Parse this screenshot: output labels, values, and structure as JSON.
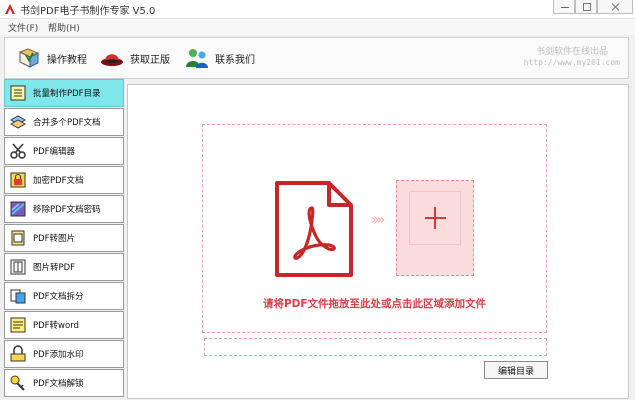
{
  "window": {
    "title": "书剑PDF电子书制作专家 V5.0"
  },
  "menu": [
    {
      "label": "文件(F)"
    },
    {
      "label": "帮助(H)"
    }
  ],
  "toolbar": {
    "items": [
      {
        "label": "操作教程",
        "icon": "book-icon"
      },
      {
        "label": "获取正版",
        "icon": "red-hat-icon"
      },
      {
        "label": "联系我们",
        "icon": "contacts-icon"
      }
    ],
    "brand_name": "书剑软件在线出品",
    "brand_url": "http://www.my201.com"
  },
  "sidebar": {
    "items": [
      {
        "label": "批量制作PDF目录",
        "icon": "catalog-icon",
        "active": true
      },
      {
        "label": "合并多个PDF文档",
        "icon": "merge-icon"
      },
      {
        "label": "PDF编辑器",
        "icon": "editor-icon"
      },
      {
        "label": "加密PDF文档",
        "icon": "encrypt-icon"
      },
      {
        "label": "移除PDF文档密码",
        "icon": "remove-password-icon"
      },
      {
        "label": "PDF转图片",
        "icon": "pdf-to-image-icon"
      },
      {
        "label": "图片转PDF",
        "icon": "image-to-pdf-icon"
      },
      {
        "label": "PDF文档拆分",
        "icon": "split-icon"
      },
      {
        "label": "PDF转word",
        "icon": "pdf-to-word-icon"
      },
      {
        "label": "PDF添加水印",
        "icon": "watermark-icon"
      },
      {
        "label": "PDF文档解锁",
        "icon": "unlock-icon"
      }
    ]
  },
  "main": {
    "drop_hint": "请将PDF文件拖放至此处或点击此区域添加文件",
    "arrows": "»»",
    "edit_button": "编辑目录"
  },
  "colors": {
    "accent_red": "#d13b3b",
    "active_item": "#7fe6ea"
  }
}
